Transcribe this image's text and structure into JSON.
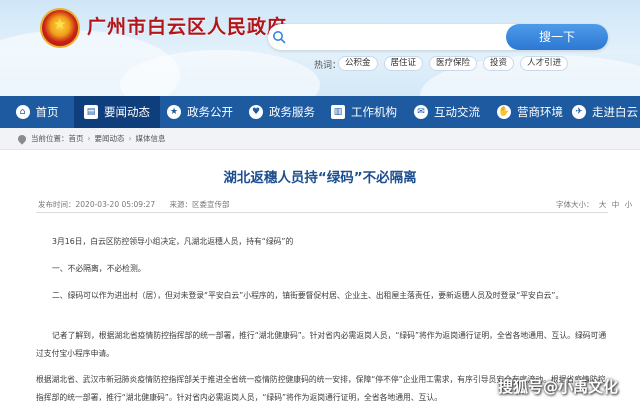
{
  "header": {
    "site_title": "广州市白云区人民政府",
    "search": {
      "placeholder": "",
      "button_label": "搜一下"
    },
    "hot_label": "热词：",
    "hot_tags": [
      "公积金",
      "居住证",
      "医疗保险",
      "投资",
      "人才引进"
    ]
  },
  "nav": {
    "items": [
      {
        "label": "首页",
        "icon": "home-icon"
      },
      {
        "label": "要闻动态",
        "icon": "news-icon",
        "active": true
      },
      {
        "label": "政务公开",
        "icon": "star-icon"
      },
      {
        "label": "政务服务",
        "icon": "heart-icon"
      },
      {
        "label": "工作机构",
        "icon": "building-icon"
      },
      {
        "label": "互动交流",
        "icon": "chat-icon"
      },
      {
        "label": "营商环境",
        "icon": "handshake-icon"
      },
      {
        "label": "走进白云",
        "icon": "plane-icon"
      }
    ]
  },
  "breadcrumb": {
    "prefix": "当前位置：",
    "items": [
      "首页",
      "要闻动态",
      "媒体信息"
    ]
  },
  "article": {
    "title": "湖北返穗人员持“绿码”不必隔离",
    "published": "发布时间：2020-03-20 05:09:27",
    "source": "来源：区委宣传部",
    "font_size_label": "字体大小：",
    "font_sizes": [
      "大",
      "中",
      "小"
    ],
    "paragraphs": [
      "3月16日，白云区防控领导小组决定，凡湖北返穗人员，持有“绿码”的",
      "一、不必隔离，不必检测。",
      "二、绿码可以作为进出村（居），但对未登录“平安白云”小程序的，镇街要督促村居、企业主、出租屋主落责任，要新返穗人员及时登录“平安白云”。",
      "记者了解到，根据湖北省疫情防控指挥部的统一部署，推行“湖北健康码”。针对省内必需返岗人员，“绿码”将作为返岗通行证明，全省各地通用、互认。绿码可通过支付宝小程序申请。",
      "根据湖北省、武汉市新冠肺炎疫情防控指挥部关于推进全省统一疫情防控健康码的统一安排，保障“停不停”企业用工需求，有序引导员安全有序流动。根据省疫情防控指挥部的统一部署，推行“湖北健康码”。针对省内必需返岗人员，“绿码”将作为返岗通行证明，全省各地通用、互认。"
    ]
  },
  "watermark": "搜狐号@小禹文化",
  "colors": {
    "nav_bg": "#1e5aa0",
    "nav_active": "#0f3e7d",
    "title_red": "#b2161a",
    "article_title": "#1d4f8f",
    "search_button": "#3a86de"
  }
}
